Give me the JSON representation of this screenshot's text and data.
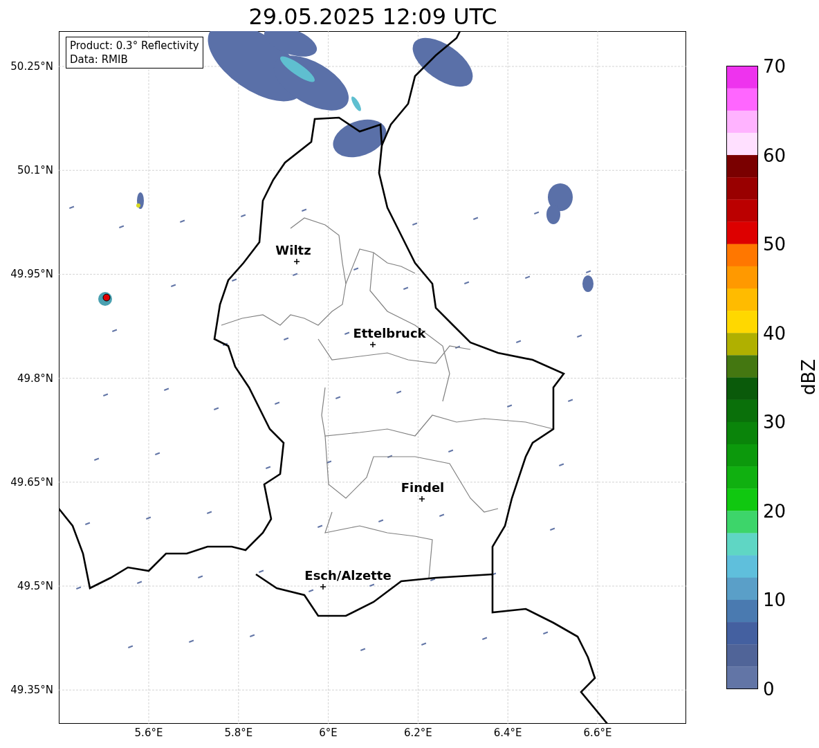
{
  "title": "29.05.2025 12:09 UTC",
  "info_box": [
    "Product: 0.3° Reflectivity",
    "Data: RMIB"
  ],
  "map": {
    "kind": "map",
    "cities": [
      {
        "name": "Wiltz"
      },
      {
        "name": "Ettelbruck"
      },
      {
        "name": "Findel"
      },
      {
        "name": "Esch/Alzette"
      }
    ],
    "y_ticks": [
      "50.25°N",
      "50.1°N",
      "49.95°N",
      "49.8°N",
      "49.65°N",
      "49.5°N",
      "49.35°N"
    ],
    "x_ticks": [
      "5.6°E",
      "5.8°E",
      "6°E",
      "6.2°E",
      "6.4°E",
      "6.6°E"
    ]
  },
  "colorbar": {
    "label": "dBZ",
    "ticks": [
      "70",
      "60",
      "50",
      "40",
      "30",
      "20",
      "10",
      "0"
    ],
    "segments": [
      {
        "color": "#ee33ee"
      },
      {
        "color": "#ff66ff"
      },
      {
        "color": "#ffb3ff"
      },
      {
        "color": "#ffe0ff"
      },
      {
        "color": "#7a0000"
      },
      {
        "color": "#990000"
      },
      {
        "color": "#bb0000"
      },
      {
        "color": "#dd0000"
      },
      {
        "color": "#ff7700"
      },
      {
        "color": "#ff9900"
      },
      {
        "color": "#ffbb00"
      },
      {
        "color": "#ffd800"
      },
      {
        "color": "#b0b000"
      },
      {
        "color": "#447711"
      },
      {
        "color": "#0a5a0a"
      },
      {
        "color": "#0a700a"
      },
      {
        "color": "#0a840a"
      },
      {
        "color": "#0c990c"
      },
      {
        "color": "#10b010"
      },
      {
        "color": "#10c810"
      },
      {
        "color": "#3dd56a"
      },
      {
        "color": "#5fd6c4"
      },
      {
        "color": "#5fbfdc"
      },
      {
        "color": "#5a9fc8"
      },
      {
        "color": "#4a7ab0"
      },
      {
        "color": "#4460a0"
      },
      {
        "color": "#506498"
      },
      {
        "color": "#6275a6"
      }
    ]
  }
}
